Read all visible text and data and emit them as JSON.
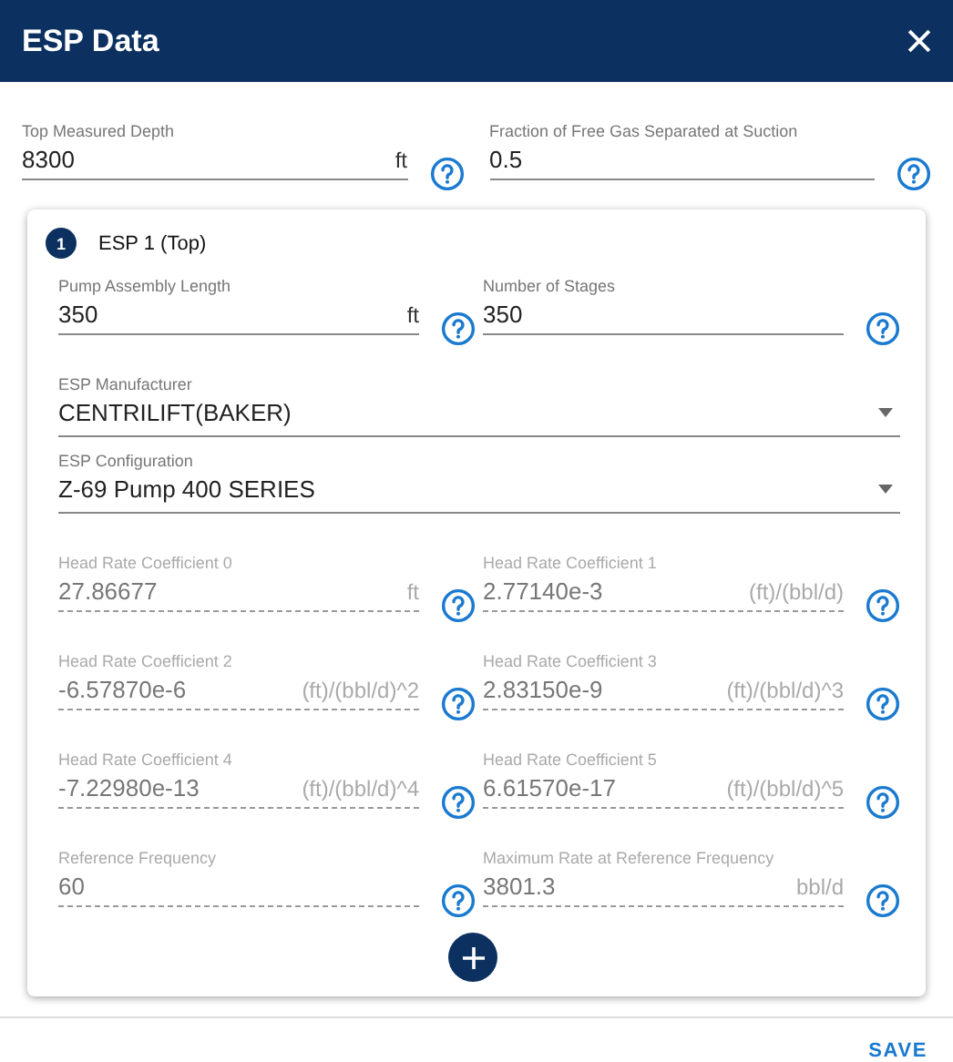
{
  "dialog": {
    "title": "ESP Data"
  },
  "fields": [
    {
      "label": "Top Measured Depth",
      "value": "8300",
      "unit": "ft",
      "disabled": false
    },
    {
      "label": "Fraction of Free Gas Separated at Suction",
      "value": "0.5",
      "disabled": false
    }
  ],
  "esp_sections": [
    {
      "number": "1",
      "title": "ESP 1 (Top)",
      "items": [
        {
          "kind": "field",
          "label": "Pump Assembly Length",
          "value": "350",
          "unit": "ft",
          "disabled": false
        },
        {
          "kind": "field",
          "label": "Number of Stages",
          "value": "350",
          "disabled": false
        },
        {
          "kind": "select",
          "label": "ESP Manufacturer",
          "value": "CENTRILIFT(BAKER)"
        },
        {
          "kind": "select",
          "label": "ESP Configuration",
          "value": "Z-69 Pump 400 SERIES"
        },
        {
          "kind": "field",
          "label": "Head Rate Coefficient 0",
          "value": "27.86677",
          "unit": "ft",
          "disabled": true
        },
        {
          "kind": "field",
          "label": "Head Rate Coefficient 1",
          "value": "2.77140e-3",
          "unit": "(ft)/(bbl/d)",
          "disabled": true
        },
        {
          "kind": "field",
          "label": "Head Rate Coefficient 2",
          "value": "-6.57870e-6",
          "unit": "(ft)/(bbl/d)^2",
          "disabled": true
        },
        {
          "kind": "field",
          "label": "Head Rate Coefficient 3",
          "value": "2.83150e-9",
          "unit": "(ft)/(bbl/d)^3",
          "disabled": true
        },
        {
          "kind": "field",
          "label": "Head Rate Coefficient 4",
          "value": "-7.22980e-13",
          "unit": "(ft)/(bbl/d)^4",
          "disabled": true
        },
        {
          "kind": "field",
          "label": "Head Rate Coefficient 5",
          "value": "6.61570e-17",
          "unit": "(ft)/(bbl/d)^5",
          "disabled": true
        },
        {
          "kind": "field",
          "label": "Reference Frequency",
          "value": "60",
          "disabled": true
        },
        {
          "kind": "field",
          "label": "Maximum Rate at Reference Frequency",
          "value": "3801.3",
          "unit": "bbl/d",
          "disabled": true
        }
      ]
    }
  ],
  "actions": [
    "SAVE"
  ]
}
